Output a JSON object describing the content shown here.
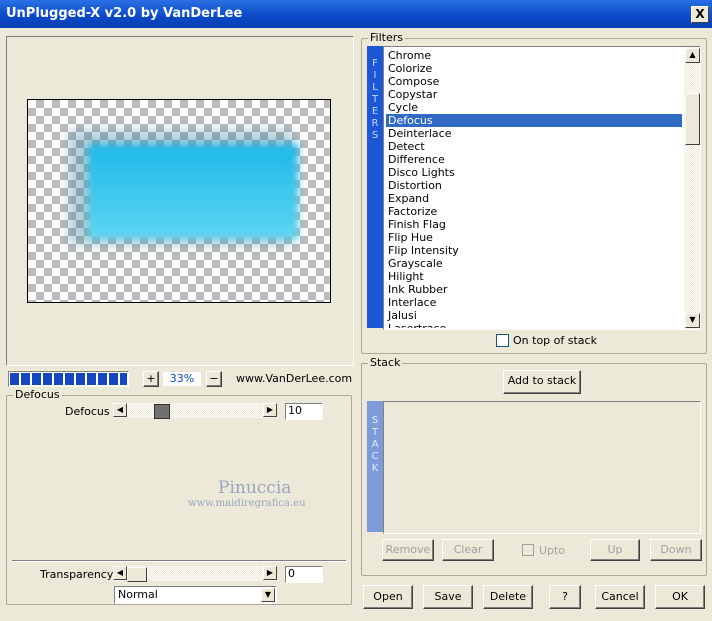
{
  "window": {
    "title": "UnPlugged-X v2.0 by VanDerLee",
    "close_glyph": "X"
  },
  "zoom": {
    "plus": "+",
    "value": "33%",
    "minus": "−"
  },
  "website": "www.VanDerLee.com",
  "effect_panel": {
    "group_label": "Defocus",
    "param_label": "Defocus",
    "param_value": "10",
    "watermark_line1": "Pinuccia",
    "watermark_line2": "www.maidiregrafica.eu",
    "transparency_label": "Transparency",
    "transparency_value": "0",
    "blend_mode": "Normal"
  },
  "filters": {
    "group_label": "Filters",
    "side_letters": [
      "F",
      "I",
      "L",
      "T",
      "E",
      "R",
      "S"
    ],
    "items": [
      "Chrome",
      "Colorize",
      "Compose",
      "Copystar",
      "Cycle",
      "Defocus",
      "Deinterlace",
      "Detect",
      "Difference",
      "Disco Lights",
      "Distortion",
      "Expand",
      "Factorize",
      "Finish Flag",
      "Flip Hue",
      "Flip Intensity",
      "Grayscale",
      "Hilight",
      "Ink Rubber",
      "Interlace",
      "Jalusi",
      "Lasertrace"
    ],
    "selected": "Defocus",
    "on_top_label": "On top of stack"
  },
  "stack": {
    "group_label": "Stack",
    "add_label": "Add to stack",
    "side_letters": [
      "S",
      "T",
      "A",
      "C",
      "K"
    ],
    "remove_label": "Remove",
    "clear_label": "Clear",
    "upto_label": "Upto",
    "up_label": "Up",
    "down_label": "Down"
  },
  "buttons": {
    "open": "Open",
    "save": "Save",
    "delete": "Delete",
    "help": "?",
    "cancel": "Cancel",
    "ok": "OK"
  },
  "colors": {
    "title_bar": "#0b48c8",
    "selection": "#316ac5",
    "preview_cyan": "#22c4ec"
  }
}
